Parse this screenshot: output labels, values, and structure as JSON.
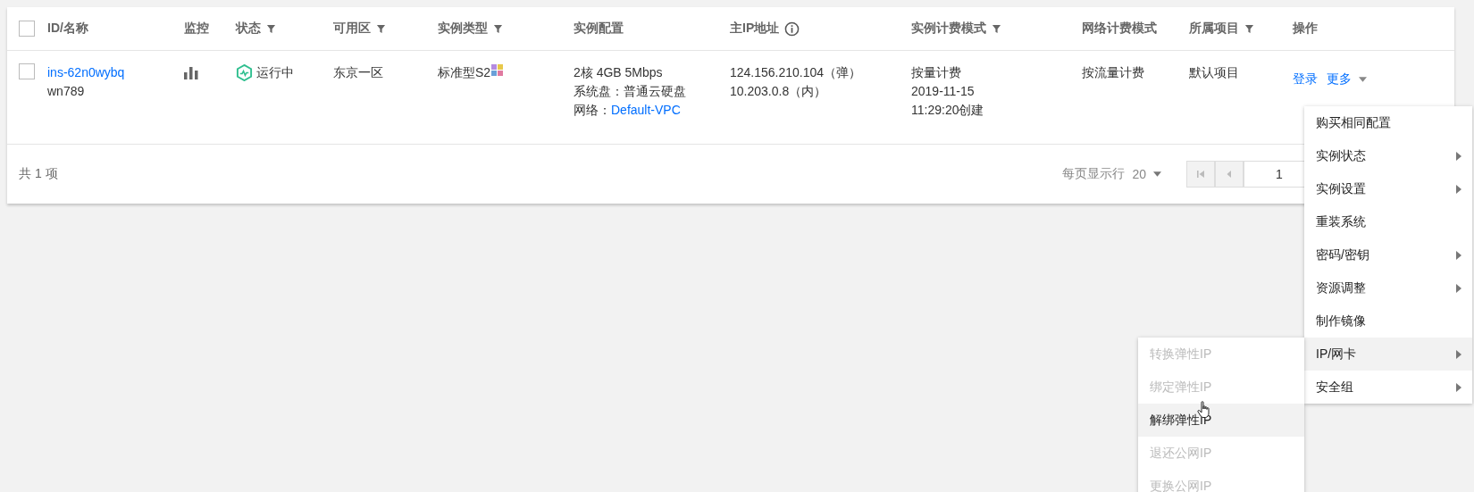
{
  "table": {
    "select_all": {
      "checked": false
    },
    "columns": [
      {
        "label": "ID/名称",
        "kind": "plain"
      },
      {
        "label": "监控",
        "kind": "plain"
      },
      {
        "label": "状态",
        "kind": "filter"
      },
      {
        "label": "可用区",
        "kind": "filter"
      },
      {
        "label": "实例类型",
        "kind": "filter"
      },
      {
        "label": "实例配置",
        "kind": "plain"
      },
      {
        "label": "主IP地址",
        "kind": "info"
      },
      {
        "label": "实例计费模式",
        "kind": "filter"
      },
      {
        "label": "网络计费模式",
        "kind": "plain"
      },
      {
        "label": "所属项目",
        "kind": "filter"
      },
      {
        "label": "操作",
        "kind": "plain"
      }
    ],
    "rows": [
      {
        "checked": false,
        "id": "ins-62n0wybq",
        "name": "wn789",
        "status": "运行中",
        "zone": "东京一区",
        "type": "标准型S2",
        "config": [
          "2核 4GB 5Mbps",
          "系统盘：普通云硬盘"
        ],
        "network_label": "网络：",
        "network": "Default-VPC",
        "ips": [
          "124.156.210.104（弹）",
          "10.203.0.8（内）"
        ],
        "billing": [
          "按量计费",
          "2019-11-15",
          "11:29:20创建"
        ],
        "net_billing": "按流量计费",
        "project": "默认项目",
        "actions": [
          "登录",
          "更多"
        ]
      }
    ]
  },
  "footer": {
    "total": "共 1 项",
    "page_size_label": "每页显示行",
    "page_size": "20",
    "page": "1"
  },
  "menu": [
    {
      "label": "购买相同配置",
      "submenu": false,
      "highlighted": false
    },
    {
      "label": "实例状态",
      "submenu": true,
      "highlighted": false
    },
    {
      "label": "实例设置",
      "submenu": true,
      "highlighted": false
    },
    {
      "label": "重装系统",
      "submenu": false,
      "highlighted": false
    },
    {
      "label": "密码/密钥",
      "submenu": true,
      "highlighted": false
    },
    {
      "label": "资源调整",
      "submenu": true,
      "highlighted": false
    },
    {
      "label": "制作镜像",
      "submenu": false,
      "highlighted": false
    },
    {
      "label": "IP/网卡",
      "submenu": true,
      "highlighted": true
    },
    {
      "label": "安全组",
      "submenu": true,
      "highlighted": false
    }
  ],
  "submenu": [
    {
      "label": "转换弹性IP",
      "disabled": true,
      "highlighted": false
    },
    {
      "label": "绑定弹性IP",
      "disabled": true,
      "highlighted": false
    },
    {
      "label": "解绑弹性IP",
      "disabled": false,
      "highlighted": true
    },
    {
      "label": "退还公网IP",
      "disabled": true,
      "highlighted": false
    },
    {
      "label": "更换公网IP",
      "disabled": true,
      "highlighted": false
    }
  ]
}
